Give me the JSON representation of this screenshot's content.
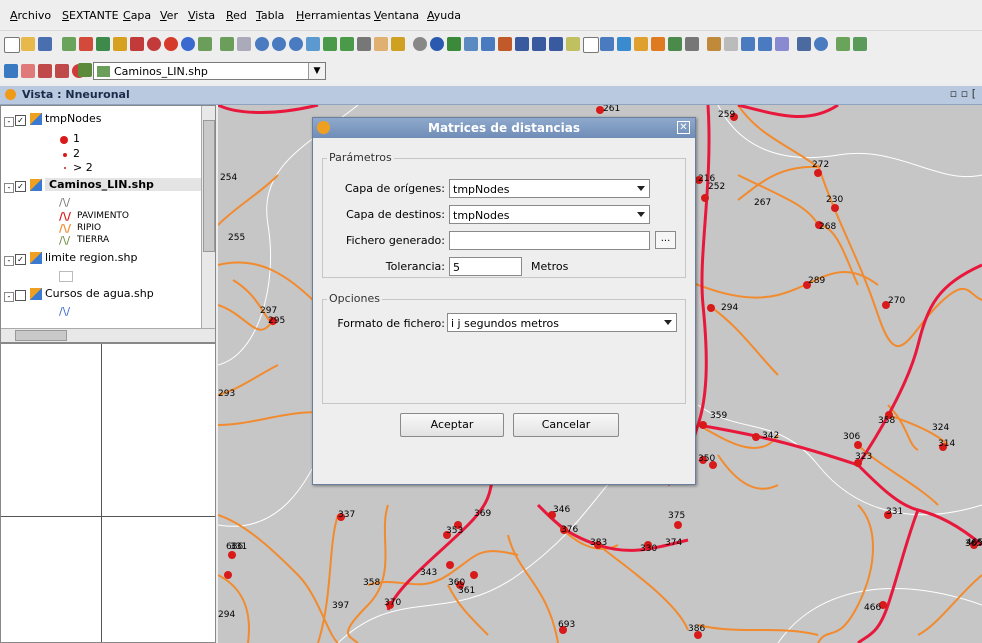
{
  "menu": [
    "Archivo",
    "SEXTANTE",
    "Capa",
    "Ver",
    "Vista",
    "Red",
    "Tabla",
    "Herramientas",
    "Ventana",
    "Ayuda"
  ],
  "toolbar2": {
    "layer_select_value": "Caminos_LIN.shp"
  },
  "view": {
    "title": "Vista : Nneuronal"
  },
  "toc": {
    "layers": [
      {
        "name": "tmpNodes",
        "checked": true,
        "legend": [
          "1",
          "2",
          "> 2"
        ]
      },
      {
        "name": "Caminos_LIN.shp",
        "checked": true,
        "legend": [
          "PAVIMENTO",
          "RIPIO",
          "TIERRA"
        ]
      },
      {
        "name": "limite region.shp",
        "checked": true
      },
      {
        "name": "Cursos de agua.shp",
        "checked": false
      }
    ]
  },
  "dialog": {
    "title": "Matrices de distancias",
    "parametros_label": "Parámetros",
    "origen_label": "Capa de orígenes:",
    "origen_value": "tmpNodes",
    "destino_label": "Capa de destinos:",
    "destino_value": "tmpNodes",
    "fichero_label": "Fichero generado:",
    "fichero_value": "",
    "browse_label": "...",
    "tolerancia_label": "Tolerancia:",
    "tolerancia_value": "5",
    "tolerancia_unit": "Metros",
    "opciones_label": "Opciones",
    "formato_label": "Formato de fichero:",
    "formato_value": "i j segundos metros",
    "accept_label": "Aceptar",
    "cancel_label": "Cancelar"
  },
  "map": {
    "node_labels": [
      "261",
      "259",
      "254",
      "255",
      "272",
      "230",
      "267",
      "268",
      "289",
      "270",
      "294",
      "297",
      "295",
      "216",
      "252",
      "293",
      "359",
      "342",
      "306",
      "358",
      "324",
      "314",
      "323",
      "350",
      "337",
      "346",
      "376",
      "383",
      "330",
      "374",
      "375",
      "331",
      "365",
      "369",
      "353",
      "331",
      "358",
      "343",
      "360",
      "361",
      "370",
      "397",
      "294",
      "686",
      "693",
      "386",
      "466",
      "465"
    ]
  },
  "colors": {
    "paved": "#e8183c",
    "gravel": "#f28a2e",
    "map_bg": "#c6c6c6",
    "title_bar": "#7b96c0"
  }
}
